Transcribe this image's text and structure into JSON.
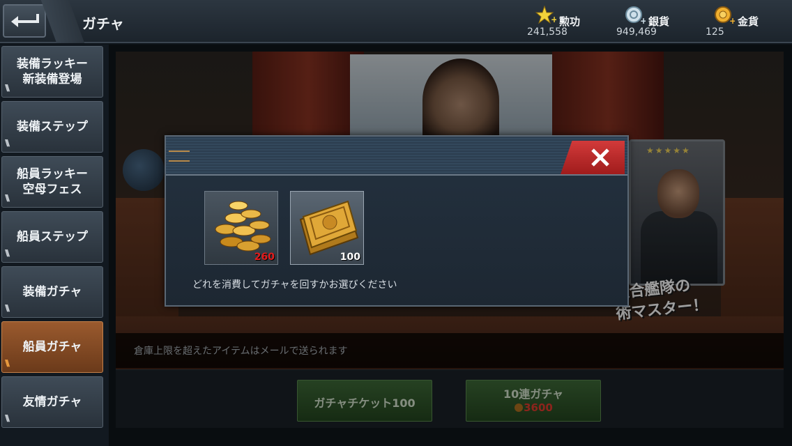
{
  "header": {
    "title": "ガチャ",
    "currencies": [
      {
        "name": "勲功",
        "amount": "241,558",
        "icon": "star-icon"
      },
      {
        "name": "銀貨",
        "amount": "949,469",
        "icon": "silver-coin-icon"
      },
      {
        "name": "金貨",
        "amount": "125",
        "icon": "gold-coin-icon"
      }
    ]
  },
  "sidebar": {
    "items": [
      {
        "label": "装備ラッキー\n新装備登場"
      },
      {
        "label": "装備ステップ"
      },
      {
        "label": "船員ラッキー\n空母フェス"
      },
      {
        "label": "船員ステップ"
      },
      {
        "label": "装備ガチャ"
      },
      {
        "label": "船員ガチャ",
        "active": true
      },
      {
        "label": "友情ガチャ"
      }
    ]
  },
  "banner": {
    "promo": "連合艦隊の\n術マスター！",
    "stars": "★★★★★"
  },
  "notice": "倉庫上限を超えたアイテムはメールで送られます",
  "actions": {
    "ticket_label": "ガチャチケット100",
    "ten_label": "10連ガチャ",
    "ten_cost": "3600"
  },
  "modal": {
    "options": [
      {
        "name": "gold-coins",
        "qty": "260"
      },
      {
        "name": "gacha-ticket",
        "qty": "100"
      }
    ],
    "message": "どれを消費してガチャを回すかお選びください"
  },
  "colors": {
    "active_tab": "#9a5a2e",
    "close": "#d23a3a",
    "action": "#3e6a38"
  }
}
